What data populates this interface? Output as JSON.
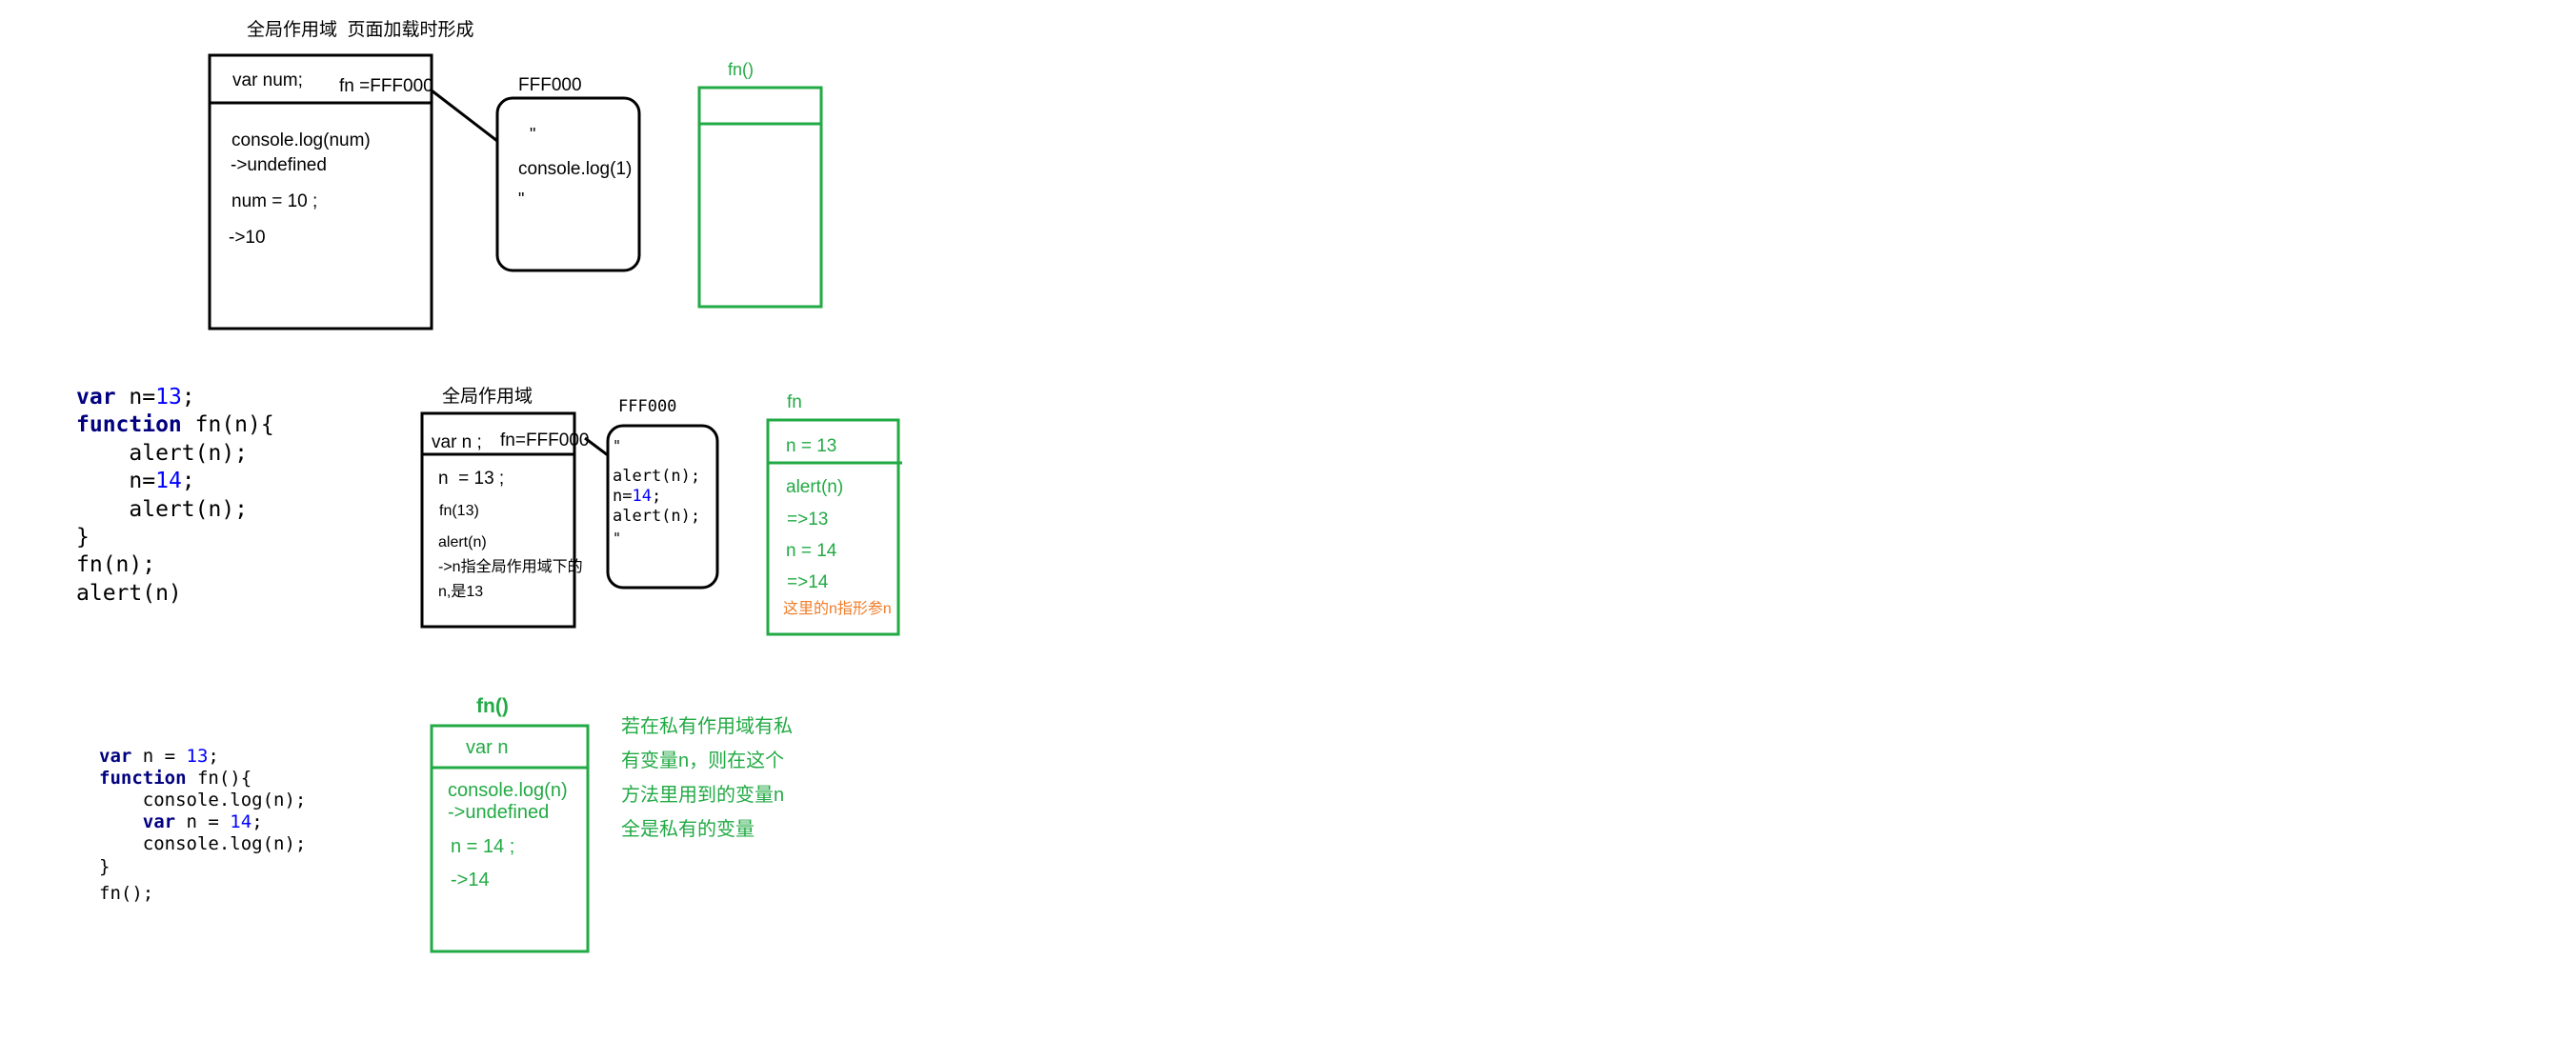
{
  "colors": {
    "black": "#000000",
    "green": "#22aa44",
    "orange": "#f07d2a",
    "keyword": "#000080",
    "number": "#0000ff"
  },
  "d1": {
    "caption": "全局作用域  页面加载时形成",
    "var_decl": "var num;",
    "fn_ref": "fn =FFF000",
    "lines": [
      "console.log(num)",
      "->undefined",
      "num = 10 ;",
      "->10"
    ],
    "heap_label": "FFF000",
    "heap_lines": [
      "\"",
      "console.log(1)",
      "\""
    ],
    "fn_label": "fn()"
  },
  "d2": {
    "code": {
      "l1": {
        "kw": "var",
        "text": " n=",
        "num": "13",
        "end": ";"
      },
      "l2": {
        "kw": "function",
        "text": " fn(n){"
      },
      "l3": "    alert(n);",
      "l4": {
        "text": "    n=",
        "num": "14",
        "end": ";"
      },
      "l5": "    alert(n);",
      "l6": "}",
      "l7": "fn(n);",
      "l8": "alert(n)"
    },
    "caption": "全局作用域",
    "var_decl": "var n ;",
    "fn_ref": "fn=FFF000",
    "lines": [
      "n  = 13 ;",
      "fn(13)",
      "alert(n)",
      "->n指全局作用域下的",
      "n,是13"
    ],
    "heap_label": "FFF000",
    "heap_lines": [
      "\"",
      "alert(n);",
      "n=",
      "14",
      ";",
      "alert(n);",
      "\""
    ],
    "fn_label": "fn",
    "fn_top": "n = 13",
    "fn_lines": [
      "alert(n)",
      "=>13",
      "n = 14",
      "=>14"
    ],
    "fn_note": "这里的n指形参n"
  },
  "d3": {
    "code": {
      "l1": {
        "kw": "var",
        "text": " n = ",
        "num": "13",
        "end": ";"
      },
      "l2": {
        "kw": "function",
        "text": " fn(){"
      },
      "l3": "    console.log(n);",
      "l4": {
        "pre": "    ",
        "kw": "var",
        "text": " n = ",
        "num": "14",
        "end": ";"
      },
      "l5": "    console.log(n);",
      "l6": "}",
      "l7": "fn();"
    },
    "fn_label": "fn()",
    "var_decl": "var n",
    "lines": [
      "console.log(n)",
      "->undefined",
      "n = 14 ;",
      "->14"
    ],
    "note": [
      "若在私有作用域有私",
      "有变量n，则在这个",
      "方法里用到的变量n",
      "全是私有的变量"
    ]
  }
}
